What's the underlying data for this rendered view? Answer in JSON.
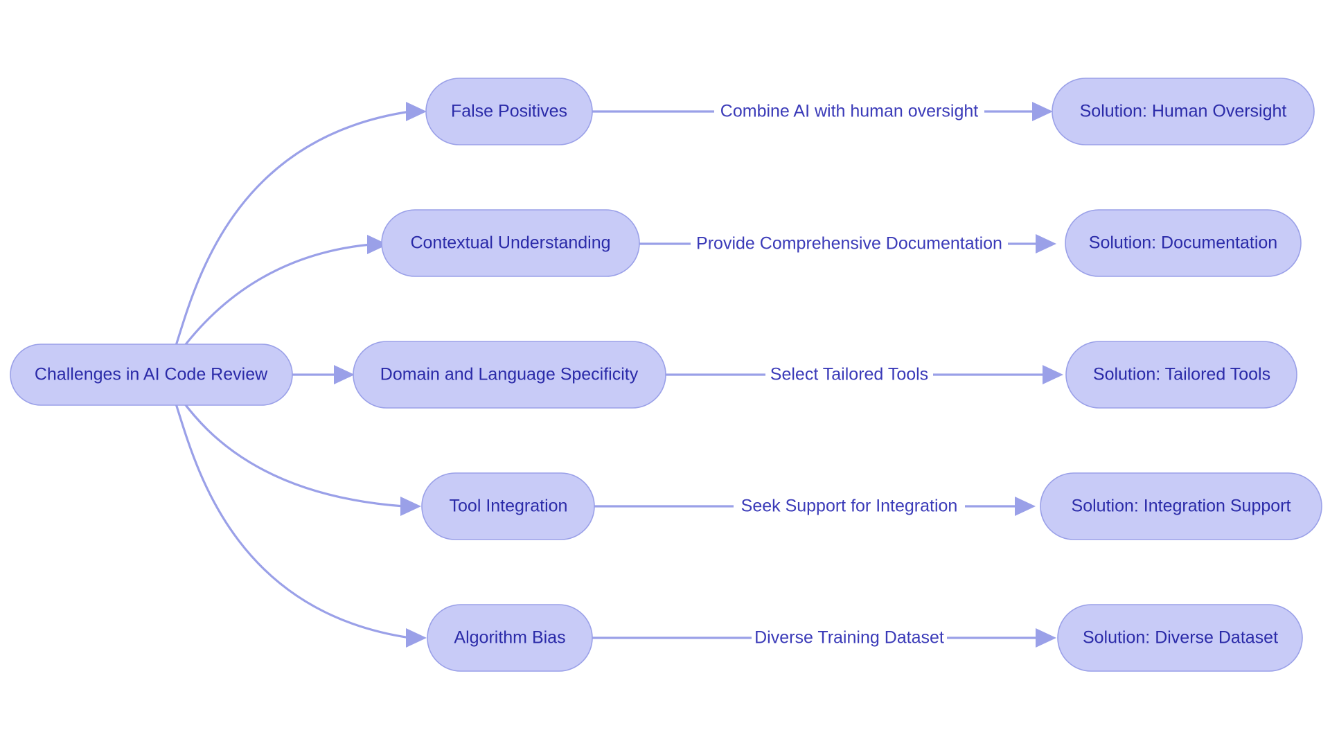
{
  "diagram": {
    "type": "flowchart",
    "orientation": "left-to-right",
    "colors": {
      "node_fill": "#c8cbf7",
      "node_stroke": "#9aa0e8",
      "node_text": "#2a2aa8",
      "edge_stroke": "#9aa0e8",
      "edge_label_text": "#3a3ab8",
      "background": "#ffffff"
    },
    "root": {
      "id": "root",
      "label": "Challenges in AI Code Review"
    },
    "challenges": [
      {
        "id": "challenge-false-positives",
        "label": "False Positives"
      },
      {
        "id": "challenge-contextual-understanding",
        "label": "Contextual Understanding"
      },
      {
        "id": "challenge-domain-language-specificity",
        "label": "Domain and Language Specificity"
      },
      {
        "id": "challenge-tool-integration",
        "label": "Tool Integration"
      },
      {
        "id": "challenge-algorithm-bias",
        "label": "Algorithm Bias"
      }
    ],
    "solutions": [
      {
        "id": "solution-human-oversight",
        "label": "Solution: Human Oversight"
      },
      {
        "id": "solution-documentation",
        "label": "Solution: Documentation"
      },
      {
        "id": "solution-tailored-tools",
        "label": "Solution: Tailored Tools"
      },
      {
        "id": "solution-integration-support",
        "label": "Solution: Integration Support"
      },
      {
        "id": "solution-diverse-dataset",
        "label": "Solution: Diverse Dataset"
      }
    ],
    "edge_labels": [
      {
        "id": "edge-label-human-oversight",
        "label": "Combine AI with human oversight"
      },
      {
        "id": "edge-label-documentation",
        "label": "Provide Comprehensive Documentation"
      },
      {
        "id": "edge-label-tailored-tools",
        "label": "Select Tailored Tools"
      },
      {
        "id": "edge-label-integration-support",
        "label": "Seek Support for Integration"
      },
      {
        "id": "edge-label-diverse-dataset",
        "label": "Diverse Training Dataset"
      }
    ]
  }
}
